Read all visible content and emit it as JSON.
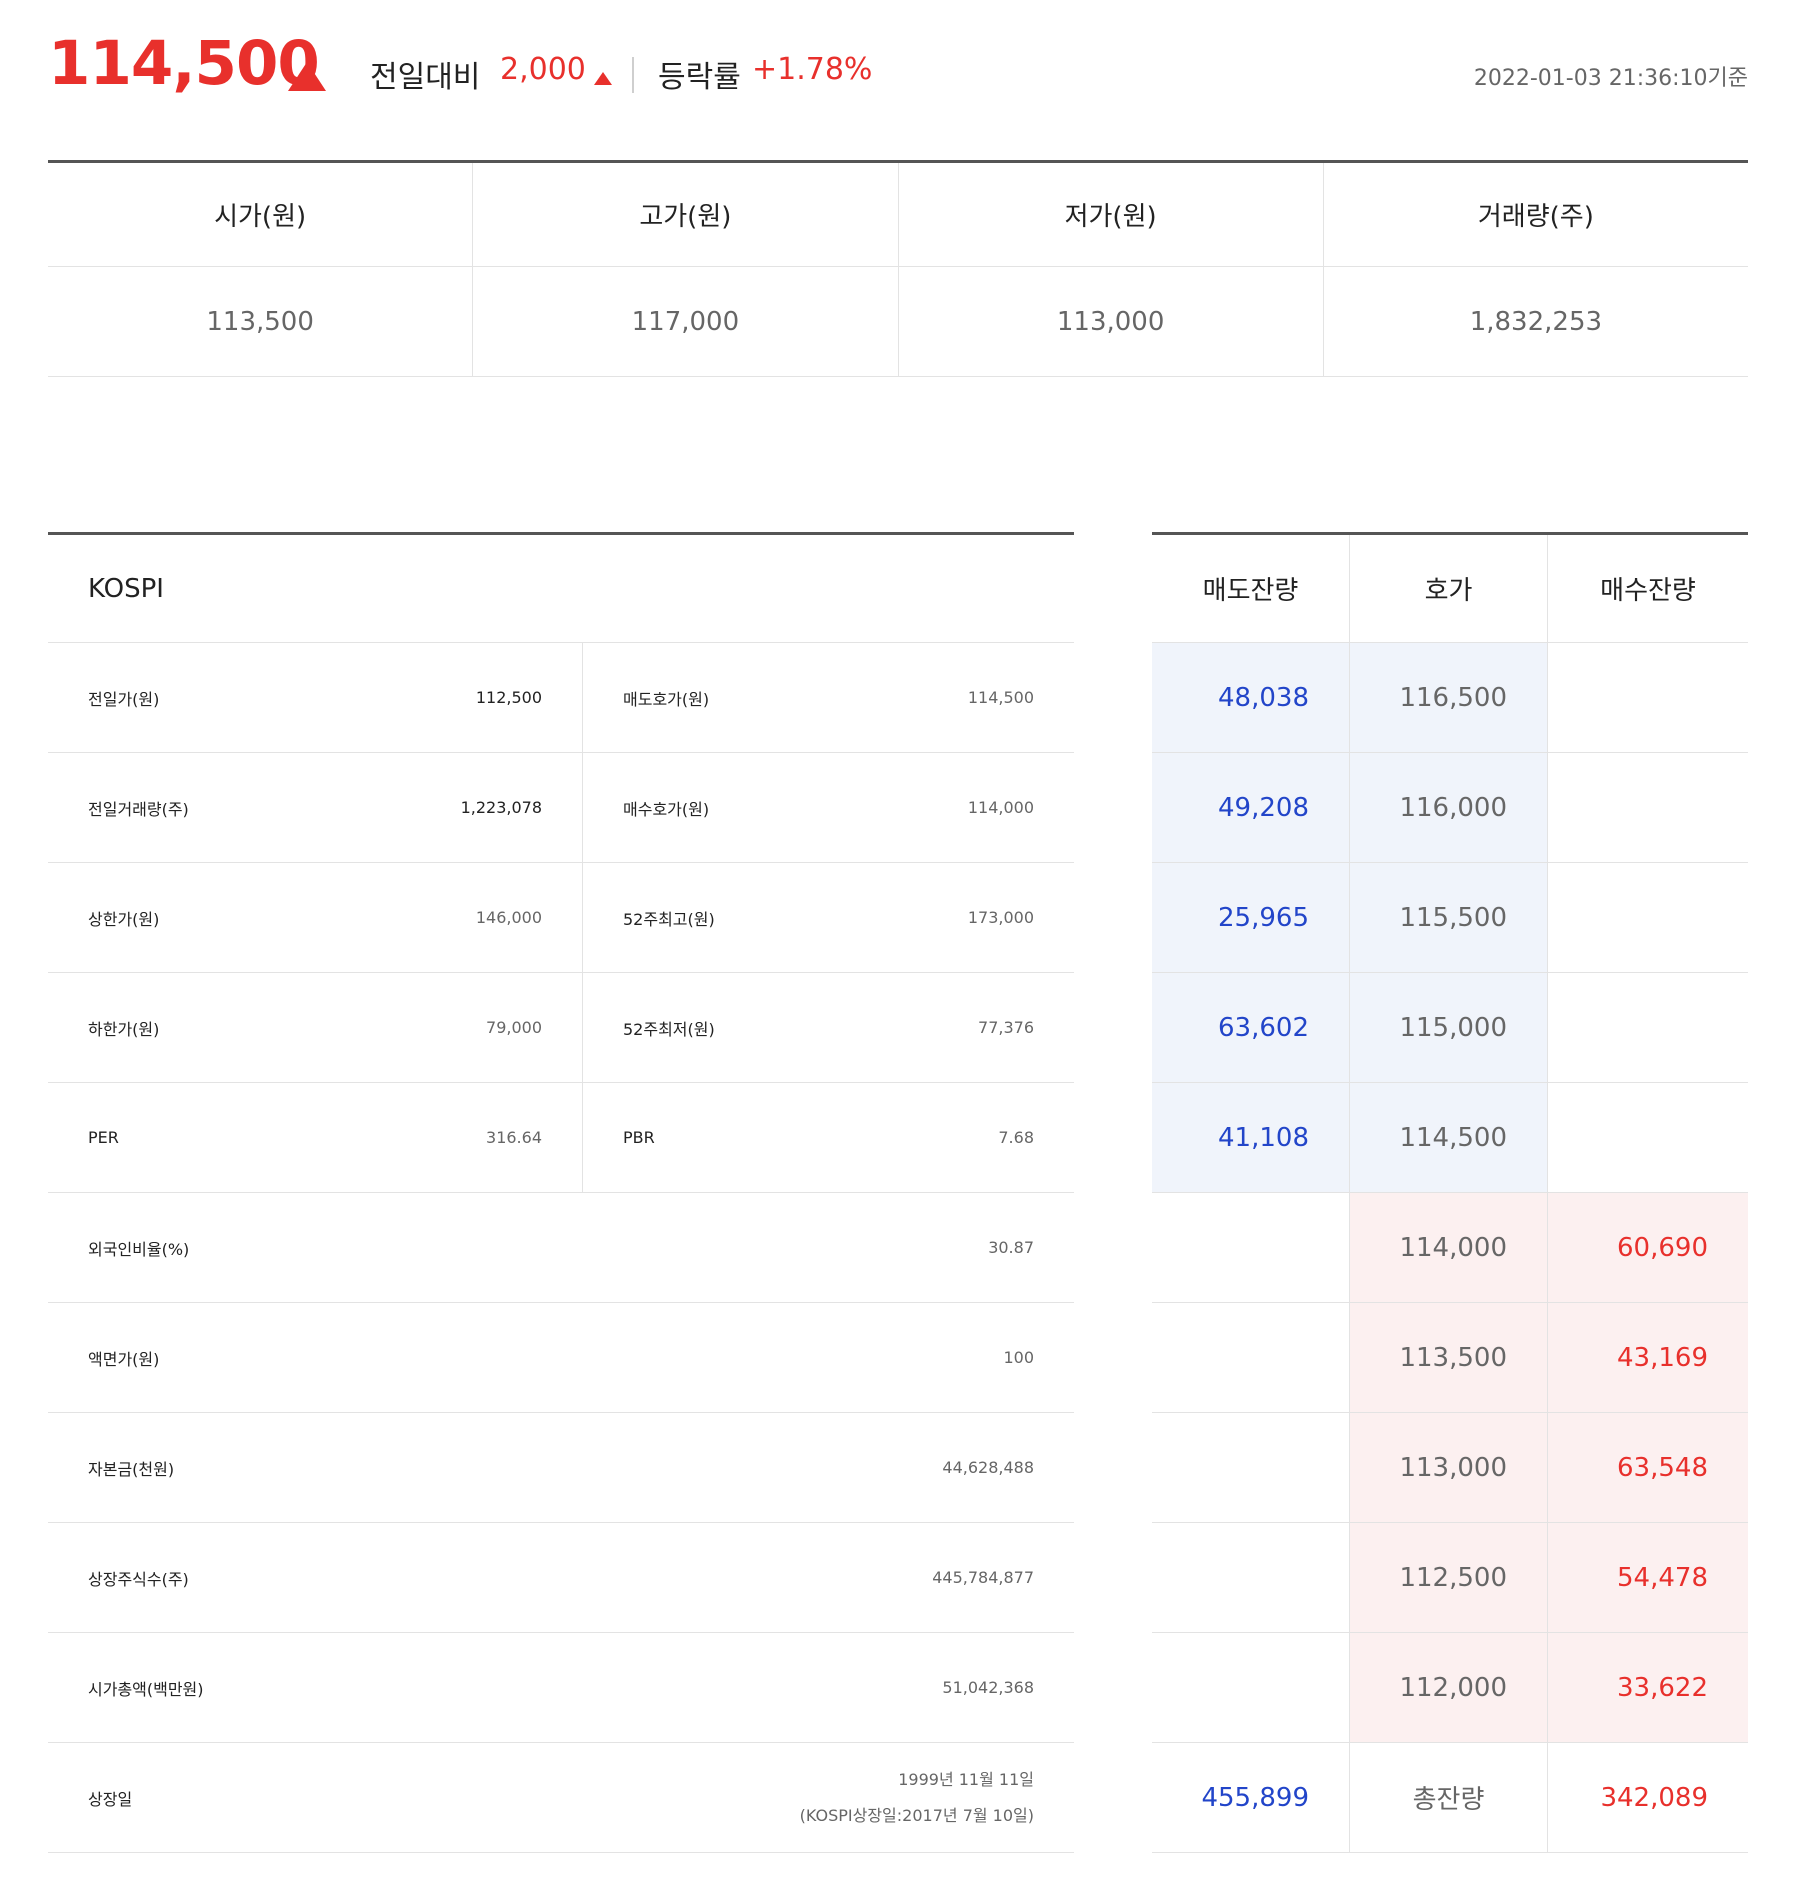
{
  "header": {
    "price": "114,500",
    "diff_label": "전일대비",
    "diff_value": "2,000",
    "rate_label": "등락률",
    "rate_value": "+1.78%",
    "timestamp": "2022-01-03 21:36:10기준",
    "up_color": "#e8302c",
    "icons": [
      "triangle-up-icon"
    ]
  },
  "summary": {
    "headers": [
      "시가(원)",
      "고가(원)",
      "저가(원)",
      "거래량(주)"
    ],
    "values": [
      "113,500",
      "117,000",
      "113,000",
      "1,832,253"
    ]
  },
  "info": {
    "market": "KOSPI",
    "pairs": [
      {
        "l1": "전일가(원)",
        "v1": "112,500",
        "l2": "매도호가(원)",
        "v2": "114,500"
      },
      {
        "l1": "전일거래량(주)",
        "v1": "1,223,078",
        "l2": "매수호가(원)",
        "v2": "114,000"
      },
      {
        "l1": "상한가(원)",
        "v1": "146,000",
        "l2": "52주최고(원)",
        "v2": "173,000"
      },
      {
        "l1": "하한가(원)",
        "v1": "79,000",
        "l2": "52주최저(원)",
        "v2": "77,376"
      },
      {
        "l1": "PER",
        "v1": "316.64",
        "l2": "PBR",
        "v2": "7.68"
      }
    ],
    "singles": [
      {
        "label": "외국인비율(%)",
        "value": "30.87"
      },
      {
        "label": "액면가(원)",
        "value": "100"
      },
      {
        "label": "자본금(천원)",
        "value": "44,628,488"
      },
      {
        "label": "상장주식수(주)",
        "value": "445,784,877"
      },
      {
        "label": "시가총액(백만원)",
        "value": "51,042,368"
      }
    ],
    "listing": {
      "label": "상장일",
      "value_line1": "1999년 11월 11일",
      "value_line2": "(KOSPI상장일:2017년 7월 10일)"
    }
  },
  "book": {
    "headers": [
      "매도잔량",
      "호가",
      "매수잔량"
    ],
    "asks": [
      {
        "qty": "48,038",
        "price": "116,500"
      },
      {
        "qty": "49,208",
        "price": "116,000"
      },
      {
        "qty": "25,965",
        "price": "115,500"
      },
      {
        "qty": "63,602",
        "price": "115,000"
      },
      {
        "qty": "41,108",
        "price": "114,500"
      }
    ],
    "bids": [
      {
        "price": "114,000",
        "qty": "60,690"
      },
      {
        "price": "113,500",
        "qty": "43,169"
      },
      {
        "price": "113,000",
        "qty": "63,548"
      },
      {
        "price": "112,500",
        "qty": "54,478"
      },
      {
        "price": "112,000",
        "qty": "33,622"
      }
    ],
    "total": {
      "sell": "455,899",
      "label": "총잔량",
      "buy": "342,089"
    },
    "sell_color": "#2245c9",
    "buy_color": "#e8302c"
  }
}
